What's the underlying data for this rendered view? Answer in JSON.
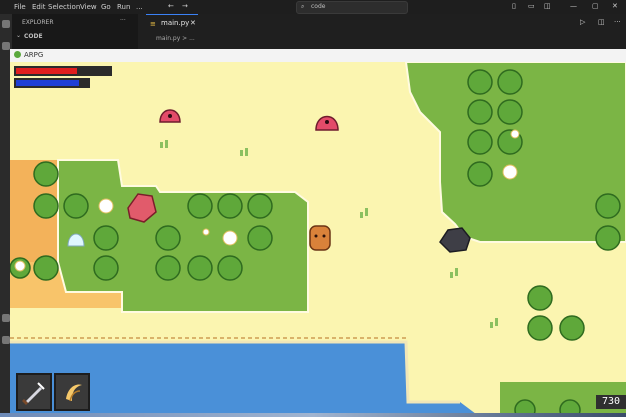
{
  "ide": {
    "menu": [
      "File",
      "Edit",
      "Selection",
      "View",
      "Go",
      "Run",
      "..."
    ],
    "search_placeholder": "code",
    "explorer_title": "EXPLORER",
    "explorer_section": "CODE",
    "tab_label": "main.py",
    "breadcrumb": "main.py > ..."
  },
  "game": {
    "window_title": "ARPG",
    "hud": {
      "health_fraction": 0.65,
      "energy_fraction": 0.88,
      "health_color": "#e01e1e",
      "energy_color": "#1e3fd6"
    },
    "score": "730",
    "abilities": [
      {
        "name": "sword-icon"
      },
      {
        "name": "claw-icon"
      }
    ]
  }
}
